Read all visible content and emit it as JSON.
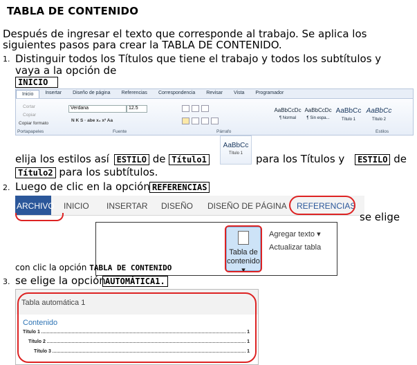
{
  "title": "TABLA DE CONTENIDO",
  "intro_line1": "Después de ingresar el texto que corresponde al trabajo.  Se aplica los",
  "intro_line2": "siguientes pasos para crear la TABLA DE CONTENIDO.",
  "step1": {
    "num": "1.",
    "line1": "Distinguir  todos los Títulos que tiene el trabajo y   todos los subtítulos y",
    "line2": "vaya a la opción de",
    "tag": "INICIO"
  },
  "ribbon": {
    "tabs": [
      "Inicio",
      "Insertar",
      "Diseño de página",
      "Referencias",
      "Correspondencia",
      "Revisar",
      "Vista",
      "Programador"
    ],
    "clipboard": [
      "Cortar",
      "Copiar",
      "Copiar formato"
    ],
    "clipboard_label": "Portapapeles",
    "font_name": "Verdana",
    "font_size": "12.5",
    "font_buttons": "N  K  S · abe  x₂  x²  Aa",
    "font_label": "Fuente",
    "paragraph_label": "Párrafo",
    "styles": [
      {
        "sample": "AaBbCcDc",
        "name": "¶ Normal"
      },
      {
        "sample": "AaBbCcDc",
        "name": "¶ Sin espa..."
      },
      {
        "sample": "AaBbCc",
        "name": "Título 1"
      },
      {
        "sample": "AaBbCc",
        "name": "Título 2"
      }
    ],
    "styles_label": "Estilos"
  },
  "step1b": {
    "a": "elija los estilos así",
    "tag1": "ESTILO",
    "b": "de",
    "tag2": "Título1",
    "c": "para los Títulos y",
    "tag3": "ESTILO",
    "d": "de",
    "tag4": "Título2",
    "e": "para los subtítulos."
  },
  "style_icon": {
    "sample": "AaBbCc",
    "name": "Título 1"
  },
  "step2": {
    "num": "2.",
    "text": "Luego de clic en la opción",
    "tag": "REFERENCIAS",
    "se_elige": "se elige",
    "conclic": "con clic la opción",
    "tag2": "TABLA DE CONTENIDO"
  },
  "menubar": [
    "ARCHIVO",
    "INICIO",
    "INSERTAR",
    "DISEÑO",
    "DISEÑO DE PÁGINA",
    "REFERENCIAS"
  ],
  "toc_panel": {
    "big_line1": "Tabla de",
    "big_line2": "contenido ▾",
    "agregar": "Agregar texto ▾",
    "actualizar": "Actualizar tabla"
  },
  "step3": {
    "num": "3.",
    "text": "se elige la opción",
    "tag": "AUTOMÁTICA1."
  },
  "auto_table": {
    "heading": "Tabla automática 1",
    "contenido": "Contenido",
    "rows": [
      {
        "label": "Título 1",
        "page": "1"
      },
      {
        "label": "Título 2",
        "page": "1"
      },
      {
        "label": "Título 3",
        "page": "1"
      }
    ]
  },
  "colors": {
    "highlight_ring": "#d22222",
    "word_blue": "#2b579a",
    "toc_blue": "#2e74b5"
  }
}
